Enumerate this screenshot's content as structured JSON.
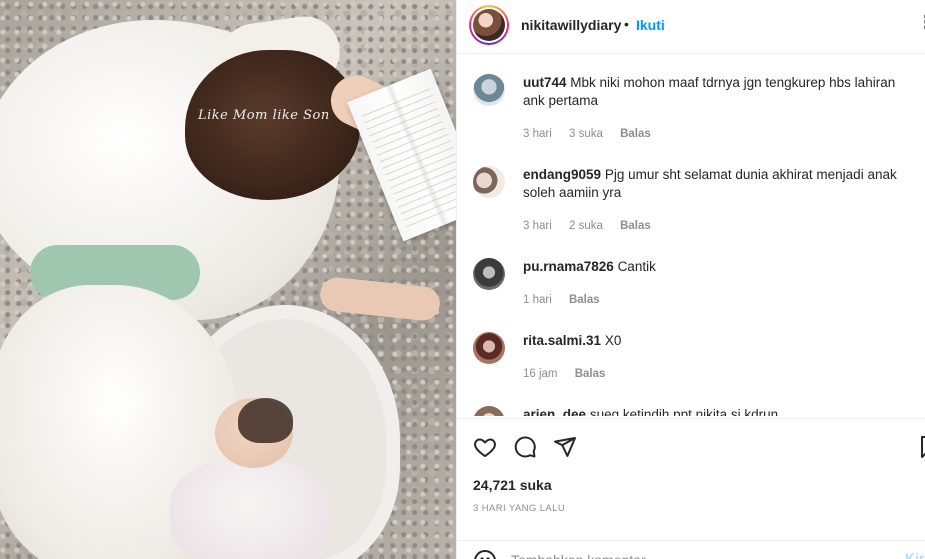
{
  "photo": {
    "watermark": "Like Mom like Son"
  },
  "header": {
    "username": "nikitawillydiary",
    "separator": "•",
    "follow_label": "Ikuti",
    "more_icon": "more-dots-icon"
  },
  "comments": [
    {
      "username": "uut744",
      "text": "Mbk niki mohon maaf tdrnya jgn tengkurep hbs lahiran ank pertama",
      "time": "3 hari",
      "likes": "3 suka",
      "reply": "Balas"
    },
    {
      "username": "endang9059",
      "text": "Pjg umur sht selamat dunia akhirat menjadi anak soleh aamiin yra",
      "time": "3 hari",
      "likes": "2 suka",
      "reply": "Balas"
    },
    {
      "username": "pu.rnama7826",
      "text": "Cantik",
      "time": "1 hari",
      "likes": "",
      "reply": "Balas"
    },
    {
      "username": "rita.salmi.31",
      "text": "X0",
      "time": "16 jam",
      "likes": "",
      "reply": "Balas"
    },
    {
      "username": "arien_dee",
      "text": "sueg ketindih ppt nikita si kdrun",
      "time": "",
      "likes": "",
      "reply": ""
    }
  ],
  "actions": {
    "like_icon": "heart-icon",
    "comment_icon": "comment-bubble-icon",
    "share_icon": "paper-plane-icon",
    "save_icon": "bookmark-icon",
    "likes_count": "24,721 suka",
    "time_ago": "3 HARI YANG LALU"
  },
  "add_comment": {
    "emoji_icon": "smiley-icon",
    "placeholder": "Tambahkan komentar...",
    "post_label": "Kirim"
  },
  "colors": {
    "accent": "#0095f6",
    "post_disabled": "#b2dffc",
    "muted": "#8e8e8e",
    "text": "#262626"
  }
}
